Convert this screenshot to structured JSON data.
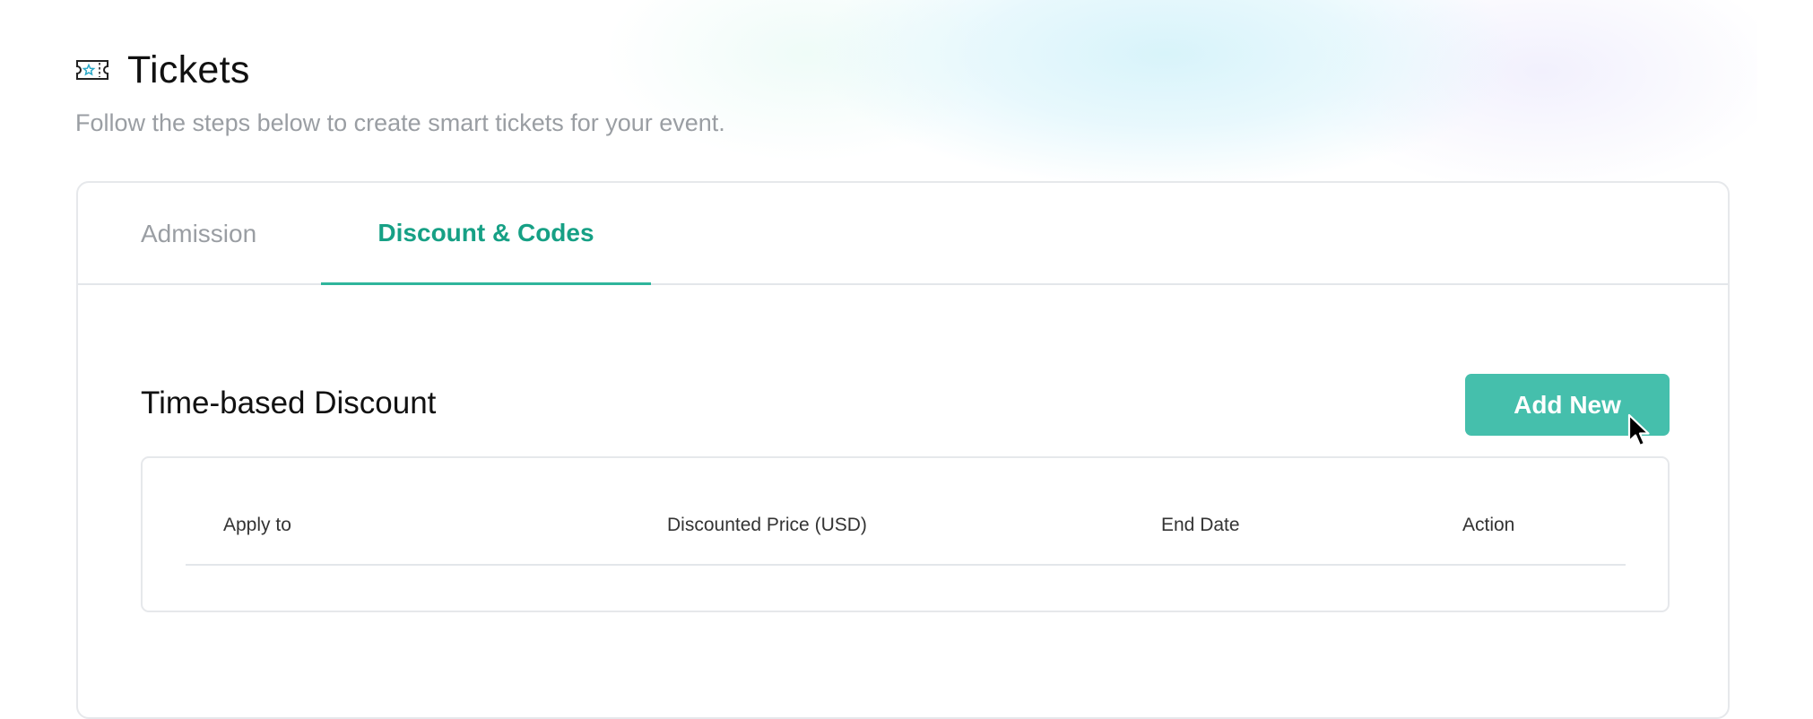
{
  "header": {
    "title": "Tickets",
    "subtitle": "Follow the steps below to create smart tickets for your event.",
    "icon": "ticket-icon"
  },
  "tabs": [
    {
      "label": "Admission",
      "active": false
    },
    {
      "label": "Discount & Codes",
      "active": true
    }
  ],
  "section": {
    "title": "Time-based Discount",
    "add_button_label": "Add New",
    "columns": [
      "Apply to",
      "Discounted Price (USD)",
      "End Date",
      "Action"
    ],
    "rows": []
  },
  "colors": {
    "accent": "#16a085",
    "button": "#45bfac",
    "muted_text": "#9a9ea3"
  }
}
